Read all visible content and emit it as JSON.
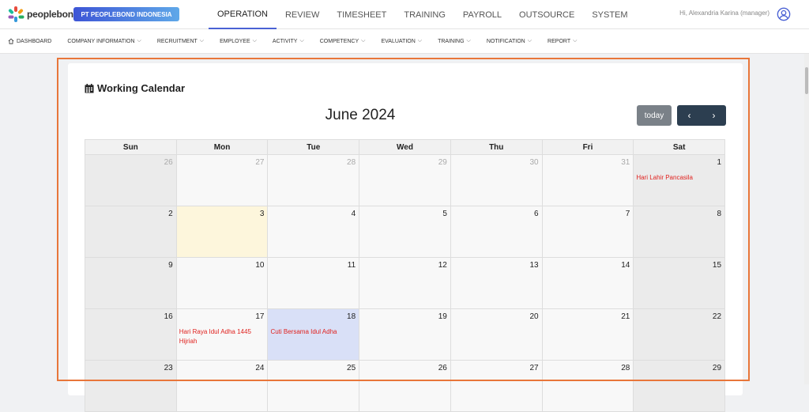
{
  "header": {
    "logo_text": "peoplebond",
    "company": "PT PEOPLEBOND INDONESIA",
    "main_nav": [
      "OPERATION",
      "REVIEW",
      "TIMESHEET",
      "TRAINING",
      "PAYROLL",
      "OUTSOURCE",
      "SYSTEM"
    ],
    "user_greeting": "Hi, Alexandria Karina (manager)"
  },
  "subnav": [
    "DASHBOARD",
    "COMPANY INFORMATION",
    "RECRUITMENT",
    "EMPLOYEE",
    "ACTIVITY",
    "COMPETENCY",
    "EVALUATION",
    "TRAINING",
    "NOTIFICATION",
    "REPORT"
  ],
  "page": {
    "title": "Working Calendar"
  },
  "calendar": {
    "title": "June 2024",
    "today_label": "today",
    "prev_icon": "chevron-left-icon",
    "next_icon": "chevron-right-icon",
    "days_of_week": [
      "Sun",
      "Mon",
      "Tue",
      "Wed",
      "Thu",
      "Fri",
      "Sat"
    ],
    "weeks": [
      [
        "26",
        "27",
        "28",
        "29",
        "30",
        "31",
        "1"
      ],
      [
        "2",
        "3",
        "4",
        "5",
        "6",
        "7",
        "8"
      ],
      [
        "9",
        "10",
        "11",
        "12",
        "13",
        "14",
        "15"
      ],
      [
        "16",
        "17",
        "18",
        "19",
        "20",
        "21",
        "22"
      ],
      [
        "23",
        "24",
        "25",
        "26",
        "27",
        "28",
        "29"
      ]
    ],
    "events": {
      "0-6": "Hari Lahir Pancasila",
      "3-1": "Hari Raya Idul Adha 1445 Hijriah",
      "3-2": "Cuti Bersama Idul Adha"
    }
  },
  "colors": {
    "accent": "#4a61d4",
    "event_text": "#e0221f",
    "highlight_border": "#e8763a"
  }
}
